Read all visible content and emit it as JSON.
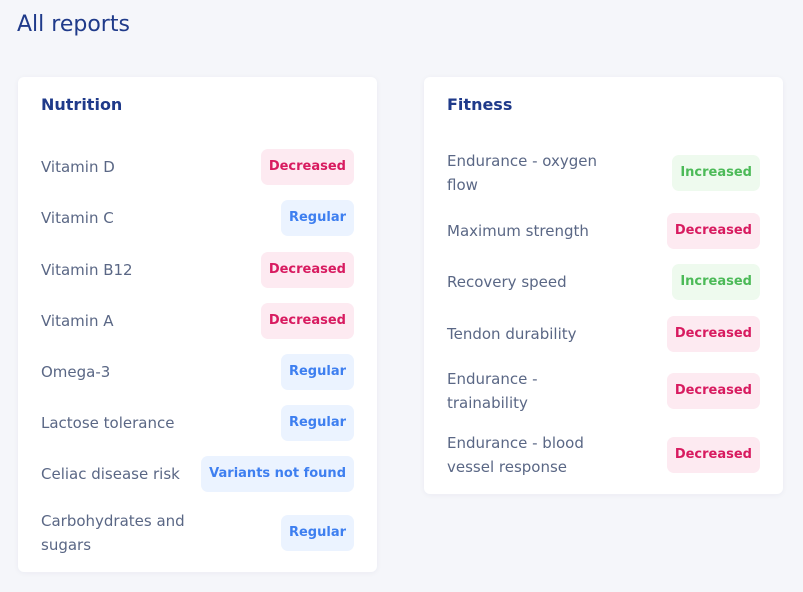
{
  "page": {
    "title": "All reports"
  },
  "colors": {
    "title": "#1f3a8a",
    "decreased_text": "#d81b60",
    "decreased_bg": "#fdeaf1",
    "regular_text": "#3e7ff0",
    "regular_bg": "#ebf3ff",
    "increased_text": "#4cba58",
    "increased_bg": "#eefaee"
  },
  "nutrition": {
    "title": "Nutrition",
    "items": [
      {
        "label": "Vitamin D",
        "status": "Decreased",
        "kind": "decreased"
      },
      {
        "label": "Vitamin C",
        "status": "Regular",
        "kind": "regular"
      },
      {
        "label": "Vitamin B12",
        "status": "Decreased",
        "kind": "decreased"
      },
      {
        "label": "Vitamin A",
        "status": "Decreased",
        "kind": "decreased"
      },
      {
        "label": "Omega-3",
        "status": "Regular",
        "kind": "regular"
      },
      {
        "label": "Lactose tolerance",
        "status": "Regular",
        "kind": "regular"
      },
      {
        "label": "Celiac disease risk",
        "status": "Variants not found",
        "kind": "regular"
      },
      {
        "label": "Carbohydrates and sugars",
        "status": "Regular",
        "kind": "regular"
      }
    ]
  },
  "fitness": {
    "title": "Fitness",
    "items": [
      {
        "label": "Endurance - oxygen flow",
        "status": "Increased",
        "kind": "increased"
      },
      {
        "label": "Maximum strength",
        "status": "Decreased",
        "kind": "decreased"
      },
      {
        "label": "Recovery speed",
        "status": "Increased",
        "kind": "increased"
      },
      {
        "label": "Tendon durability",
        "status": "Decreased",
        "kind": "decreased"
      },
      {
        "label": "Endurance - trainability",
        "status": "Decreased",
        "kind": "decreased"
      },
      {
        "label": "Endurance - blood vessel response",
        "status": "Decreased",
        "kind": "decreased"
      }
    ]
  }
}
